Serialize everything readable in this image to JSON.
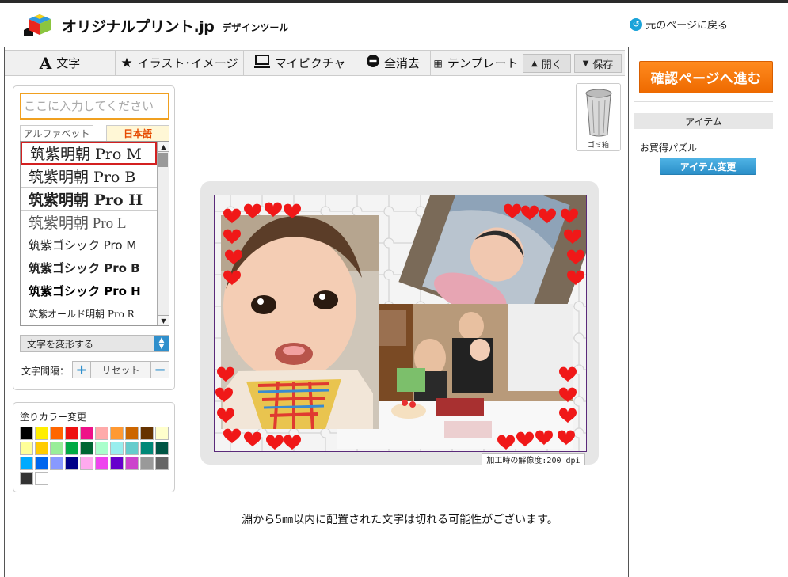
{
  "header": {
    "logo_text": "オリジナルプリント.jp",
    "logo_sub": "デザインツール",
    "back_label": "元のページに戻る"
  },
  "toolbar": {
    "items": [
      {
        "label": "文字",
        "icon": "A"
      },
      {
        "label": "イラスト･イメージ",
        "icon": "★"
      },
      {
        "label": "マイピクチャ",
        "icon": "monitor-icon"
      },
      {
        "label": "全消去",
        "icon": "minus-circle-icon"
      },
      {
        "label": "テンプレート",
        "icon": "grid-icon"
      }
    ],
    "open_label": "開く",
    "save_label": "保存"
  },
  "text_panel": {
    "input_placeholder": "ここに入力してください",
    "tab_alphabet": "アルファベット",
    "tab_japanese": "日本語",
    "fonts": [
      "筑紫明朝 Pro M",
      "筑紫明朝 Pro B",
      "筑紫明朝 Pro H",
      "筑紫明朝 Pro L",
      "筑紫ゴシック Pro M",
      "筑紫ゴシック Pro B",
      "筑紫ゴシック Pro H",
      "筑紫オールド明朝 Pro R"
    ],
    "transform_label": "文字を変形する",
    "spacing_label": "文字間隔：",
    "reset_label": "リセット"
  },
  "color_panel": {
    "title": "塗りカラー変更",
    "colors": [
      "#000000",
      "#ffee00",
      "#ff6600",
      "#ee1111",
      "#ee1188",
      "#ffaaaa",
      "#ff9933",
      "#cc6600",
      "#663300",
      "#ffffcc",
      "#ffff99",
      "#ffcc00",
      "#99ee99",
      "#00aa44",
      "#006633",
      "#aaffcc",
      "#99eeee",
      "#66cccc",
      "#008877",
      "#005544",
      "#00aaff",
      "#0066ee",
      "#8899ff",
      "#000088",
      "#ffaaee",
      "#ee44ee",
      "#6600cc",
      "#cc44cc",
      "#999999",
      "#666666",
      "#333333",
      "#ffffff"
    ]
  },
  "trash_label": "ゴミ箱",
  "right_panel": {
    "cta_label": "確認ページへ進む",
    "section_title": "アイテム",
    "item_name": "お買得パズル",
    "change_label": "アイテム変更"
  },
  "canvas": {
    "dpi_label": "加工時の解像度:200 dpi"
  },
  "notice": "淵から5㎜以内に配置された文字は切れる可能性がございます。"
}
